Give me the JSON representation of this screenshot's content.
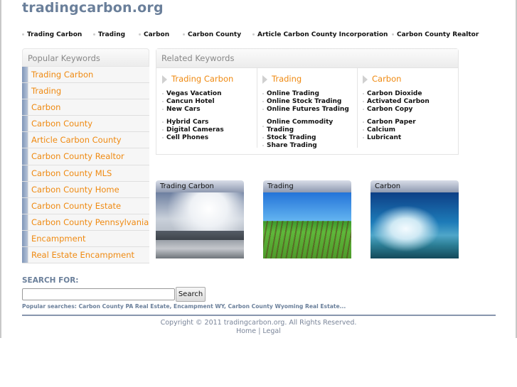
{
  "site": {
    "logo": "tradingcarbon.org"
  },
  "topnav": [
    "Trading Carbon",
    "Trading",
    "Carbon",
    "Carbon County",
    "Article Carbon County Incorporation",
    "Carbon County Realtor"
  ],
  "popular": {
    "title": "Popular Keywords",
    "items": [
      "Trading Carbon",
      "Trading",
      "Carbon",
      "Carbon County",
      "Article Carbon County",
      "Carbon County Realtor",
      "Carbon County MLS",
      "Carbon County Home",
      "Carbon County Estate",
      "Carbon County Pennsylvania",
      "Encampment",
      "Real Estate Encampment"
    ]
  },
  "related": {
    "title": "Related Keywords",
    "columns": [
      {
        "title": "Trading Carbon",
        "group1": [
          "Vegas Vacation",
          "Cancun Hotel",
          "New Cars"
        ],
        "group2": [
          "Hybrid Cars",
          "Digital Cameras",
          "Cell Phones"
        ]
      },
      {
        "title": "Trading",
        "group1": [
          "Online Trading",
          "Online Stock Trading",
          "Online Futures Trading"
        ],
        "group2": [
          "Online Commodity Trading",
          "Stock Trading",
          "Share Trading"
        ]
      },
      {
        "title": "Carbon",
        "group1": [
          "Carbon Dioxide",
          "Activated Carbon",
          "Carbon Copy"
        ],
        "group2": [
          "Carbon Paper",
          "Calcium",
          "Lubricant"
        ]
      }
    ]
  },
  "thumbnails": [
    {
      "caption": "Trading Carbon",
      "image": "mountain-clouds-photo"
    },
    {
      "caption": "Trading",
      "image": "farm-field-photo"
    },
    {
      "caption": "Carbon",
      "image": "lake-sky-photo"
    }
  ],
  "search": {
    "label": "SEARCH FOR:",
    "value": "",
    "placeholder": "",
    "button": "Search",
    "popular": "Popular searches: Carbon County PA Real Estate, Encampment WY, Carbon County Wyoming Real Estate..."
  },
  "footer": {
    "copyright": "Copyright © 2011 tradingcarbon.org. All Rights Reserved.",
    "links": [
      "Home",
      "Legal"
    ],
    "separator": "|"
  }
}
